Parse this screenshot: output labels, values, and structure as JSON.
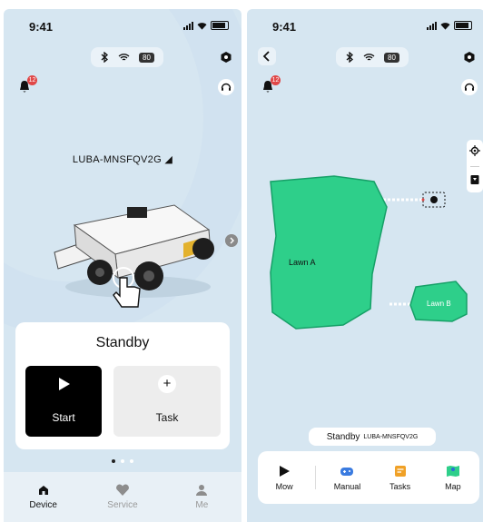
{
  "status_bar": {
    "time": "9:41",
    "battery_chip": "80"
  },
  "notifications": {
    "count": "12"
  },
  "device": {
    "name": "LUBA-MNSFQV2G",
    "status": "Standby"
  },
  "actions": {
    "start_label": "Start",
    "task_label": "Task",
    "plus": "+"
  },
  "carousel": {
    "pages": 3,
    "active_page": 1
  },
  "tabs": [
    {
      "label": "Device",
      "icon": "home-icon"
    },
    {
      "label": "Service",
      "icon": "heart-icon"
    },
    {
      "label": "Me",
      "icon": "person-icon"
    }
  ],
  "map": {
    "zones": [
      {
        "label": "Lawn A"
      },
      {
        "label": "Lawn B"
      }
    ],
    "status": "Standby",
    "device_name": "LUBA-MNSFQV2G",
    "zone_color": "#2ecf8a"
  },
  "map_actions": [
    {
      "label": "Mow",
      "icon": "play-icon"
    },
    {
      "label": "Manual",
      "icon": "gamepad-icon"
    },
    {
      "label": "Tasks",
      "icon": "tasks-icon"
    },
    {
      "label": "Map",
      "icon": "map-icon"
    }
  ],
  "colors": {
    "background": "#d6e6f1",
    "accent": "#000000",
    "badge": "#e04747"
  }
}
